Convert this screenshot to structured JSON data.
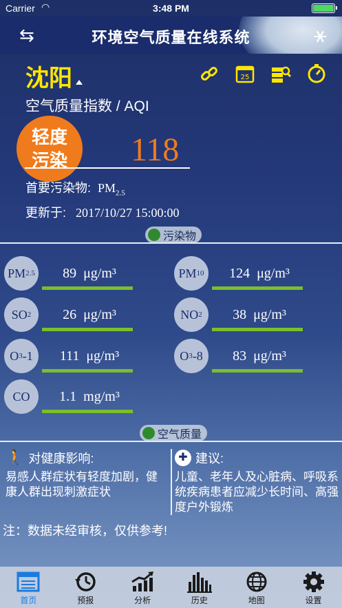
{
  "status": {
    "carrier": "Carrier",
    "time": "3:48 PM"
  },
  "nav": {
    "title": "环境空气质量在线系统"
  },
  "city": "沈阳",
  "aqi_label": "空气质量指数 / AQI",
  "level": {
    "line1": "轻度",
    "line2": "污染",
    "color": "#f07b1c"
  },
  "aqi_value": "118",
  "primary": {
    "label": "首要污染物:",
    "main": "PM",
    "sub": "2.5"
  },
  "updated": {
    "label": "更新于:",
    "time": "2017/10/27 15:00:00"
  },
  "section_pollutants": "污染物",
  "section_quality": "空气质量",
  "pollutants": [
    {
      "name": "PM",
      "sub": "2.5",
      "value": "89  μg/m³"
    },
    {
      "name": "PM",
      "sub": "10",
      "value": "124  μg/m³"
    },
    {
      "name": "SO",
      "sub": "2",
      "value": "26  μg/m³"
    },
    {
      "name": "NO",
      "sub": "2",
      "value": "38  μg/m³"
    },
    {
      "name": "O",
      "sub": "3",
      "suffix": "-1",
      "value": "111  μg/m³"
    },
    {
      "name": "O",
      "sub": "3",
      "suffix": "-8",
      "value": "83  μg/m³"
    },
    {
      "name": "CO",
      "sub": "",
      "value": "1.1  mg/m³"
    }
  ],
  "health": {
    "title": "对健康影响:",
    "text": "易感人群症状有轻度加剧，健康人群出现刺激症状"
  },
  "advice": {
    "title": "建议:",
    "text": "儿童、老年人及心脏病、呼吸系统疾病患者应减少长时间、高强度户外锻炼"
  },
  "note": "注：数据未经审核，仅供参考!",
  "tabs": [
    {
      "label": "首页",
      "icon": "home-icon"
    },
    {
      "label": "预报",
      "icon": "history-clock-icon"
    },
    {
      "label": "分析",
      "icon": "chart-up-icon"
    },
    {
      "label": "历史",
      "icon": "bars-icon"
    },
    {
      "label": "地图",
      "icon": "globe-icon"
    },
    {
      "label": "设置",
      "icon": "gear-icon"
    }
  ],
  "colors": {
    "accent": "#ffe600",
    "bar": "#7bbf2a",
    "active_tab": "#1a7be0"
  }
}
